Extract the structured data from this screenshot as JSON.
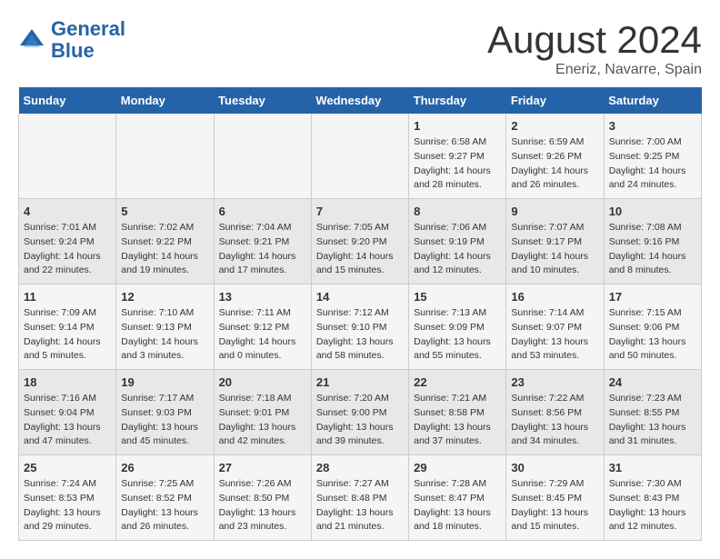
{
  "header": {
    "logo_line1": "General",
    "logo_line2": "Blue",
    "month_title": "August 2024",
    "location": "Eneriz, Navarre, Spain"
  },
  "weekdays": [
    "Sunday",
    "Monday",
    "Tuesday",
    "Wednesday",
    "Thursday",
    "Friday",
    "Saturday"
  ],
  "weeks": [
    [
      {
        "day": "",
        "info": ""
      },
      {
        "day": "",
        "info": ""
      },
      {
        "day": "",
        "info": ""
      },
      {
        "day": "",
        "info": ""
      },
      {
        "day": "1",
        "info": "Sunrise: 6:58 AM\nSunset: 9:27 PM\nDaylight: 14 hours\nand 28 minutes."
      },
      {
        "day": "2",
        "info": "Sunrise: 6:59 AM\nSunset: 9:26 PM\nDaylight: 14 hours\nand 26 minutes."
      },
      {
        "day": "3",
        "info": "Sunrise: 7:00 AM\nSunset: 9:25 PM\nDaylight: 14 hours\nand 24 minutes."
      }
    ],
    [
      {
        "day": "4",
        "info": "Sunrise: 7:01 AM\nSunset: 9:24 PM\nDaylight: 14 hours\nand 22 minutes."
      },
      {
        "day": "5",
        "info": "Sunrise: 7:02 AM\nSunset: 9:22 PM\nDaylight: 14 hours\nand 19 minutes."
      },
      {
        "day": "6",
        "info": "Sunrise: 7:04 AM\nSunset: 9:21 PM\nDaylight: 14 hours\nand 17 minutes."
      },
      {
        "day": "7",
        "info": "Sunrise: 7:05 AM\nSunset: 9:20 PM\nDaylight: 14 hours\nand 15 minutes."
      },
      {
        "day": "8",
        "info": "Sunrise: 7:06 AM\nSunset: 9:19 PM\nDaylight: 14 hours\nand 12 minutes."
      },
      {
        "day": "9",
        "info": "Sunrise: 7:07 AM\nSunset: 9:17 PM\nDaylight: 14 hours\nand 10 minutes."
      },
      {
        "day": "10",
        "info": "Sunrise: 7:08 AM\nSunset: 9:16 PM\nDaylight: 14 hours\nand 8 minutes."
      }
    ],
    [
      {
        "day": "11",
        "info": "Sunrise: 7:09 AM\nSunset: 9:14 PM\nDaylight: 14 hours\nand 5 minutes."
      },
      {
        "day": "12",
        "info": "Sunrise: 7:10 AM\nSunset: 9:13 PM\nDaylight: 14 hours\nand 3 minutes."
      },
      {
        "day": "13",
        "info": "Sunrise: 7:11 AM\nSunset: 9:12 PM\nDaylight: 14 hours\nand 0 minutes."
      },
      {
        "day": "14",
        "info": "Sunrise: 7:12 AM\nSunset: 9:10 PM\nDaylight: 13 hours\nand 58 minutes."
      },
      {
        "day": "15",
        "info": "Sunrise: 7:13 AM\nSunset: 9:09 PM\nDaylight: 13 hours\nand 55 minutes."
      },
      {
        "day": "16",
        "info": "Sunrise: 7:14 AM\nSunset: 9:07 PM\nDaylight: 13 hours\nand 53 minutes."
      },
      {
        "day": "17",
        "info": "Sunrise: 7:15 AM\nSunset: 9:06 PM\nDaylight: 13 hours\nand 50 minutes."
      }
    ],
    [
      {
        "day": "18",
        "info": "Sunrise: 7:16 AM\nSunset: 9:04 PM\nDaylight: 13 hours\nand 47 minutes."
      },
      {
        "day": "19",
        "info": "Sunrise: 7:17 AM\nSunset: 9:03 PM\nDaylight: 13 hours\nand 45 minutes."
      },
      {
        "day": "20",
        "info": "Sunrise: 7:18 AM\nSunset: 9:01 PM\nDaylight: 13 hours\nand 42 minutes."
      },
      {
        "day": "21",
        "info": "Sunrise: 7:20 AM\nSunset: 9:00 PM\nDaylight: 13 hours\nand 39 minutes."
      },
      {
        "day": "22",
        "info": "Sunrise: 7:21 AM\nSunset: 8:58 PM\nDaylight: 13 hours\nand 37 minutes."
      },
      {
        "day": "23",
        "info": "Sunrise: 7:22 AM\nSunset: 8:56 PM\nDaylight: 13 hours\nand 34 minutes."
      },
      {
        "day": "24",
        "info": "Sunrise: 7:23 AM\nSunset: 8:55 PM\nDaylight: 13 hours\nand 31 minutes."
      }
    ],
    [
      {
        "day": "25",
        "info": "Sunrise: 7:24 AM\nSunset: 8:53 PM\nDaylight: 13 hours\nand 29 minutes."
      },
      {
        "day": "26",
        "info": "Sunrise: 7:25 AM\nSunset: 8:52 PM\nDaylight: 13 hours\nand 26 minutes."
      },
      {
        "day": "27",
        "info": "Sunrise: 7:26 AM\nSunset: 8:50 PM\nDaylight: 13 hours\nand 23 minutes."
      },
      {
        "day": "28",
        "info": "Sunrise: 7:27 AM\nSunset: 8:48 PM\nDaylight: 13 hours\nand 21 minutes."
      },
      {
        "day": "29",
        "info": "Sunrise: 7:28 AM\nSunset: 8:47 PM\nDaylight: 13 hours\nand 18 minutes."
      },
      {
        "day": "30",
        "info": "Sunrise: 7:29 AM\nSunset: 8:45 PM\nDaylight: 13 hours\nand 15 minutes."
      },
      {
        "day": "31",
        "info": "Sunrise: 7:30 AM\nSunset: 8:43 PM\nDaylight: 13 hours\nand 12 minutes."
      }
    ]
  ]
}
